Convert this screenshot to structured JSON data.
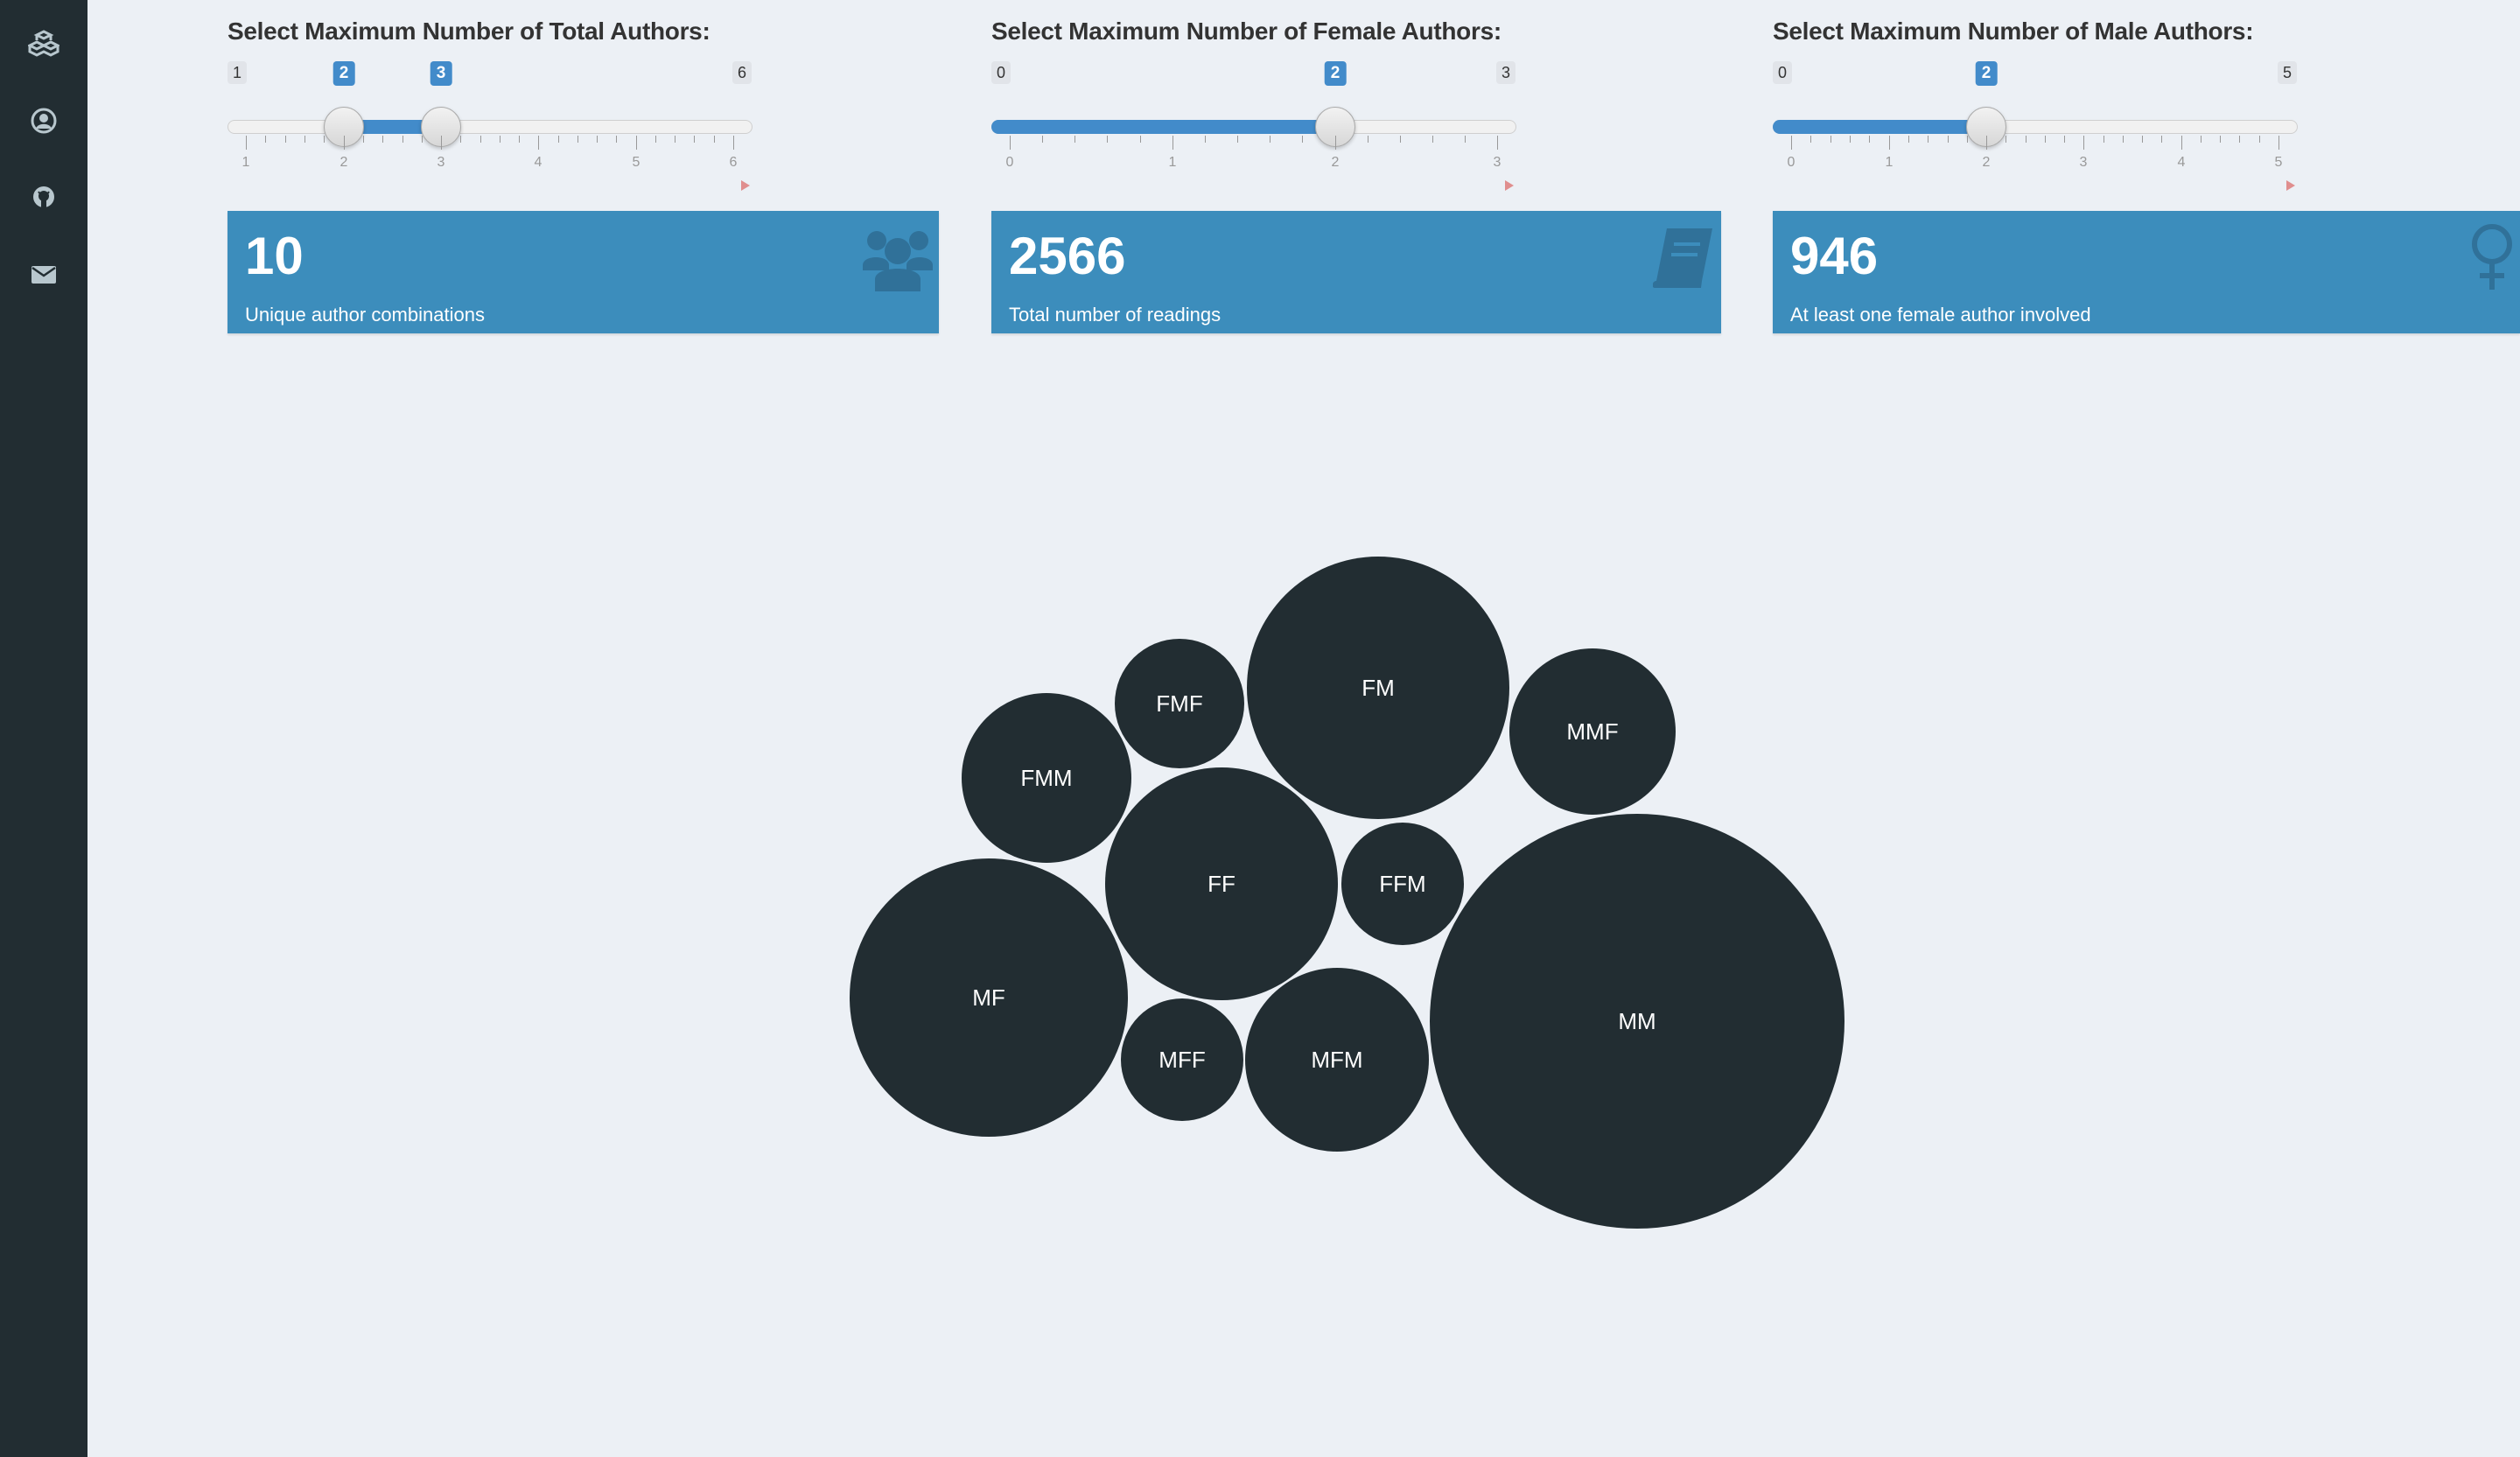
{
  "theme": {
    "sidebar_color": "#222d32",
    "background": "#ecf0f5",
    "accent": "#428bca",
    "box_color": "#3c8dbc"
  },
  "sidebar": {
    "items": [
      {
        "icon": "cubes-icon"
      },
      {
        "icon": "user-circle-icon"
      },
      {
        "icon": "github-icon"
      },
      {
        "icon": "envelope-icon"
      }
    ]
  },
  "sliders": [
    {
      "title": "Select Maximum Number of Total Authors:",
      "min": "1",
      "max": "6",
      "from": "2",
      "to": "3",
      "ticks": [
        "1",
        "2",
        "3",
        "4",
        "5",
        "6"
      ]
    },
    {
      "title": "Select Maximum Number of Female Authors:",
      "min": "0",
      "max": "3",
      "value": "2",
      "ticks": [
        "0",
        "1",
        "2",
        "3"
      ]
    },
    {
      "title": "Select Maximum Number of Male Authors:",
      "min": "0",
      "max": "5",
      "value": "2",
      "ticks": [
        "0",
        "1",
        "2",
        "3",
        "4",
        "5"
      ]
    }
  ],
  "value_boxes": [
    {
      "value": "10",
      "label": "Unique author combinations",
      "icon": "users-icon"
    },
    {
      "value": "2566",
      "label": "Total number of readings",
      "icon": "book-icon"
    },
    {
      "value": "946",
      "label": "At least one female author involved",
      "icon": "venus-icon"
    }
  ],
  "bubbles": [
    {
      "label": "FM"
    },
    {
      "label": "FMF"
    },
    {
      "label": "MMF"
    },
    {
      "label": "FMM"
    },
    {
      "label": "FF"
    },
    {
      "label": "FFM"
    },
    {
      "label": "MF"
    },
    {
      "label": "MM"
    },
    {
      "label": "MFF"
    },
    {
      "label": "MFM"
    }
  ]
}
